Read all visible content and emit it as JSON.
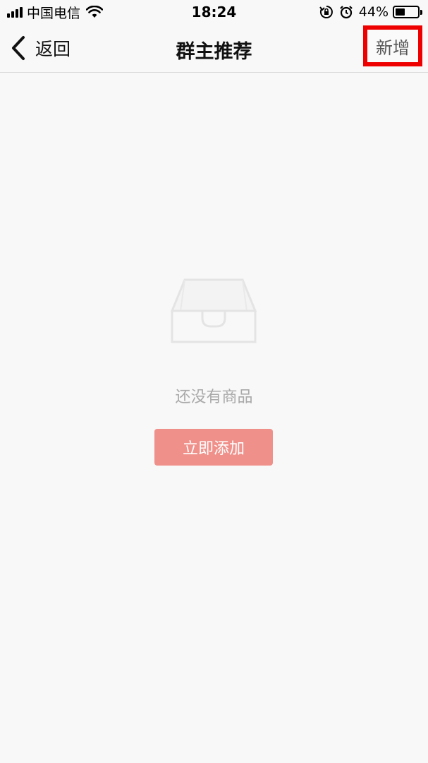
{
  "status_bar": {
    "carrier": "中国电信",
    "time": "18:24",
    "battery_percent_text": "44%",
    "battery_level": 0.44,
    "icons": [
      "signal-icon",
      "wifi-icon",
      "orientation-lock-icon",
      "alarm-icon",
      "battery-icon"
    ]
  },
  "nav": {
    "back_label": "返回",
    "title": "群主推荐",
    "add_label": "新增"
  },
  "empty_state": {
    "icon": "empty-box-icon",
    "message": "还没有商品",
    "button_label": "立即添加"
  },
  "colors": {
    "background": "#f8f8f8",
    "primary_button": "#f0908a",
    "highlight_border": "#ee0000",
    "empty_text": "#a9a9a9"
  }
}
